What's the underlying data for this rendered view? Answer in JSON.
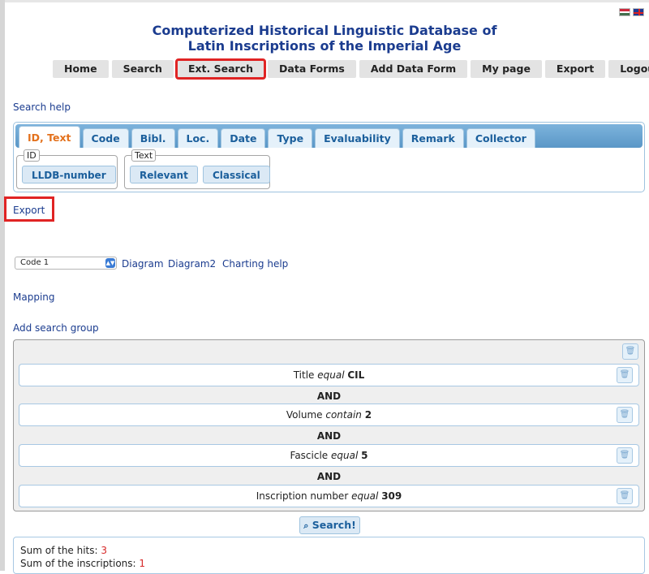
{
  "title": {
    "line1": "Computerized Historical Linguistic Database of",
    "line2": "Latin Inscriptions of the Imperial Age"
  },
  "nav": [
    "Home",
    "Search",
    "Ext. Search",
    "Data Forms",
    "Add Data Form",
    "My page",
    "Export",
    "Logout"
  ],
  "links": {
    "search_help": "Search help",
    "export": "Export",
    "diagram": "Diagram",
    "diagram2": "Diagram2",
    "charting_help": "Charting help",
    "mapping": "Mapping",
    "add_search_group": "Add search group"
  },
  "tabs": [
    "ID, Text",
    "Code",
    "Bibl.",
    "Loc.",
    "Date",
    "Type",
    "Evaluability",
    "Remark",
    "Collector"
  ],
  "fieldsets": {
    "id": {
      "legend": "ID",
      "buttons": [
        "LLDB-number"
      ]
    },
    "text": {
      "legend": "Text",
      "buttons": [
        "Relevant",
        "Classical"
      ]
    }
  },
  "select": {
    "value": "Code 1"
  },
  "conditions": [
    {
      "field": "Title",
      "op": "equal",
      "value": "CIL"
    },
    {
      "field": "Volume",
      "op": "contain",
      "value": "2"
    },
    {
      "field": "Fascicle",
      "op": "equal",
      "value": "5"
    },
    {
      "field": "Inscription number",
      "op": "equal",
      "value": "309"
    }
  ],
  "and_label": "AND",
  "search_button": "Search!",
  "results": {
    "hits_label": "Sum of the hits:",
    "hits": "3",
    "inscriptions_label": "Sum of the inscriptions:",
    "inscriptions": "1"
  },
  "colors": {
    "accent": "#1b3c8f",
    "highlight": "#e02424",
    "tab_active": "#e3711c"
  }
}
